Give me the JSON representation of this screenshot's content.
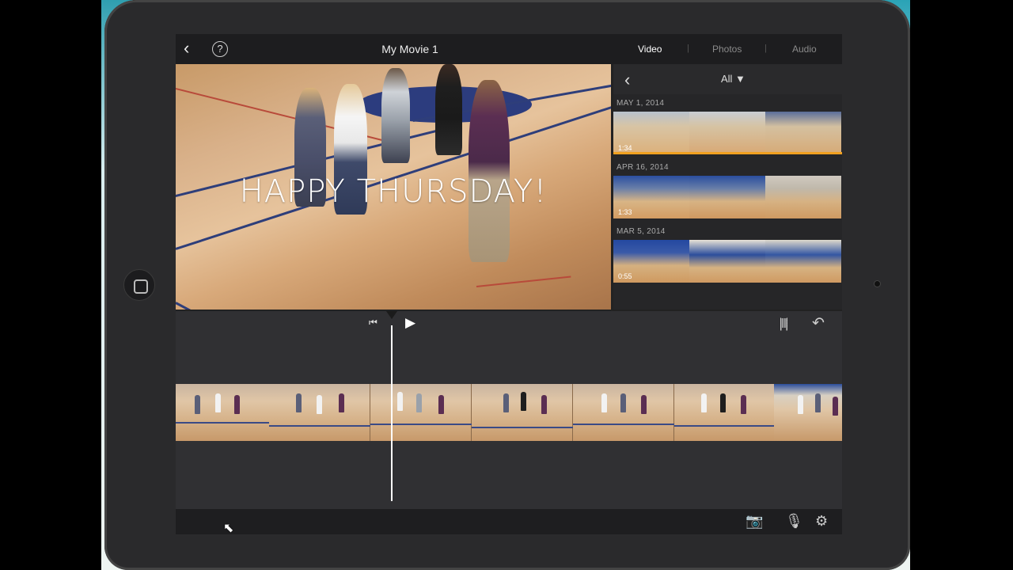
{
  "app": {
    "title": "My Movie 1",
    "tabs": [
      {
        "label": "Video",
        "active": true
      },
      {
        "label": "Photos",
        "active": false
      },
      {
        "label": "Audio",
        "active": false
      }
    ]
  },
  "viewer": {
    "title_overlay": "HAPPY THURSDAY!"
  },
  "browser": {
    "filter_label": "All ▼",
    "groups": [
      {
        "date": "MAY 1, 2014",
        "duration": "1:34"
      },
      {
        "date": "APR 16, 2014",
        "duration": "1:33"
      },
      {
        "date": "MAR 5, 2014",
        "duration": "0:55"
      }
    ]
  },
  "icons": {
    "back": "chevron-left-icon",
    "help": "question-circle-icon",
    "skip_start": "skip-to-start-icon",
    "play": "play-icon",
    "audio_wave": "audio-waveform-icon",
    "undo": "undo-icon",
    "camera": "camera-icon",
    "mic": "microphone-icon",
    "settings": "gear-icon"
  },
  "glyphs": {
    "back": "‹",
    "help": "?",
    "skip_start": "⏮",
    "play": "▶",
    "wave": "𝄄|‖|𝄄",
    "undo": "↶",
    "camera": "📷",
    "mic": "🎙",
    "settings": "⚙",
    "cursor": "⬉"
  },
  "colors": {
    "accent": "#ffffff",
    "background": "#303033",
    "topbar": "#1d1d1f"
  }
}
